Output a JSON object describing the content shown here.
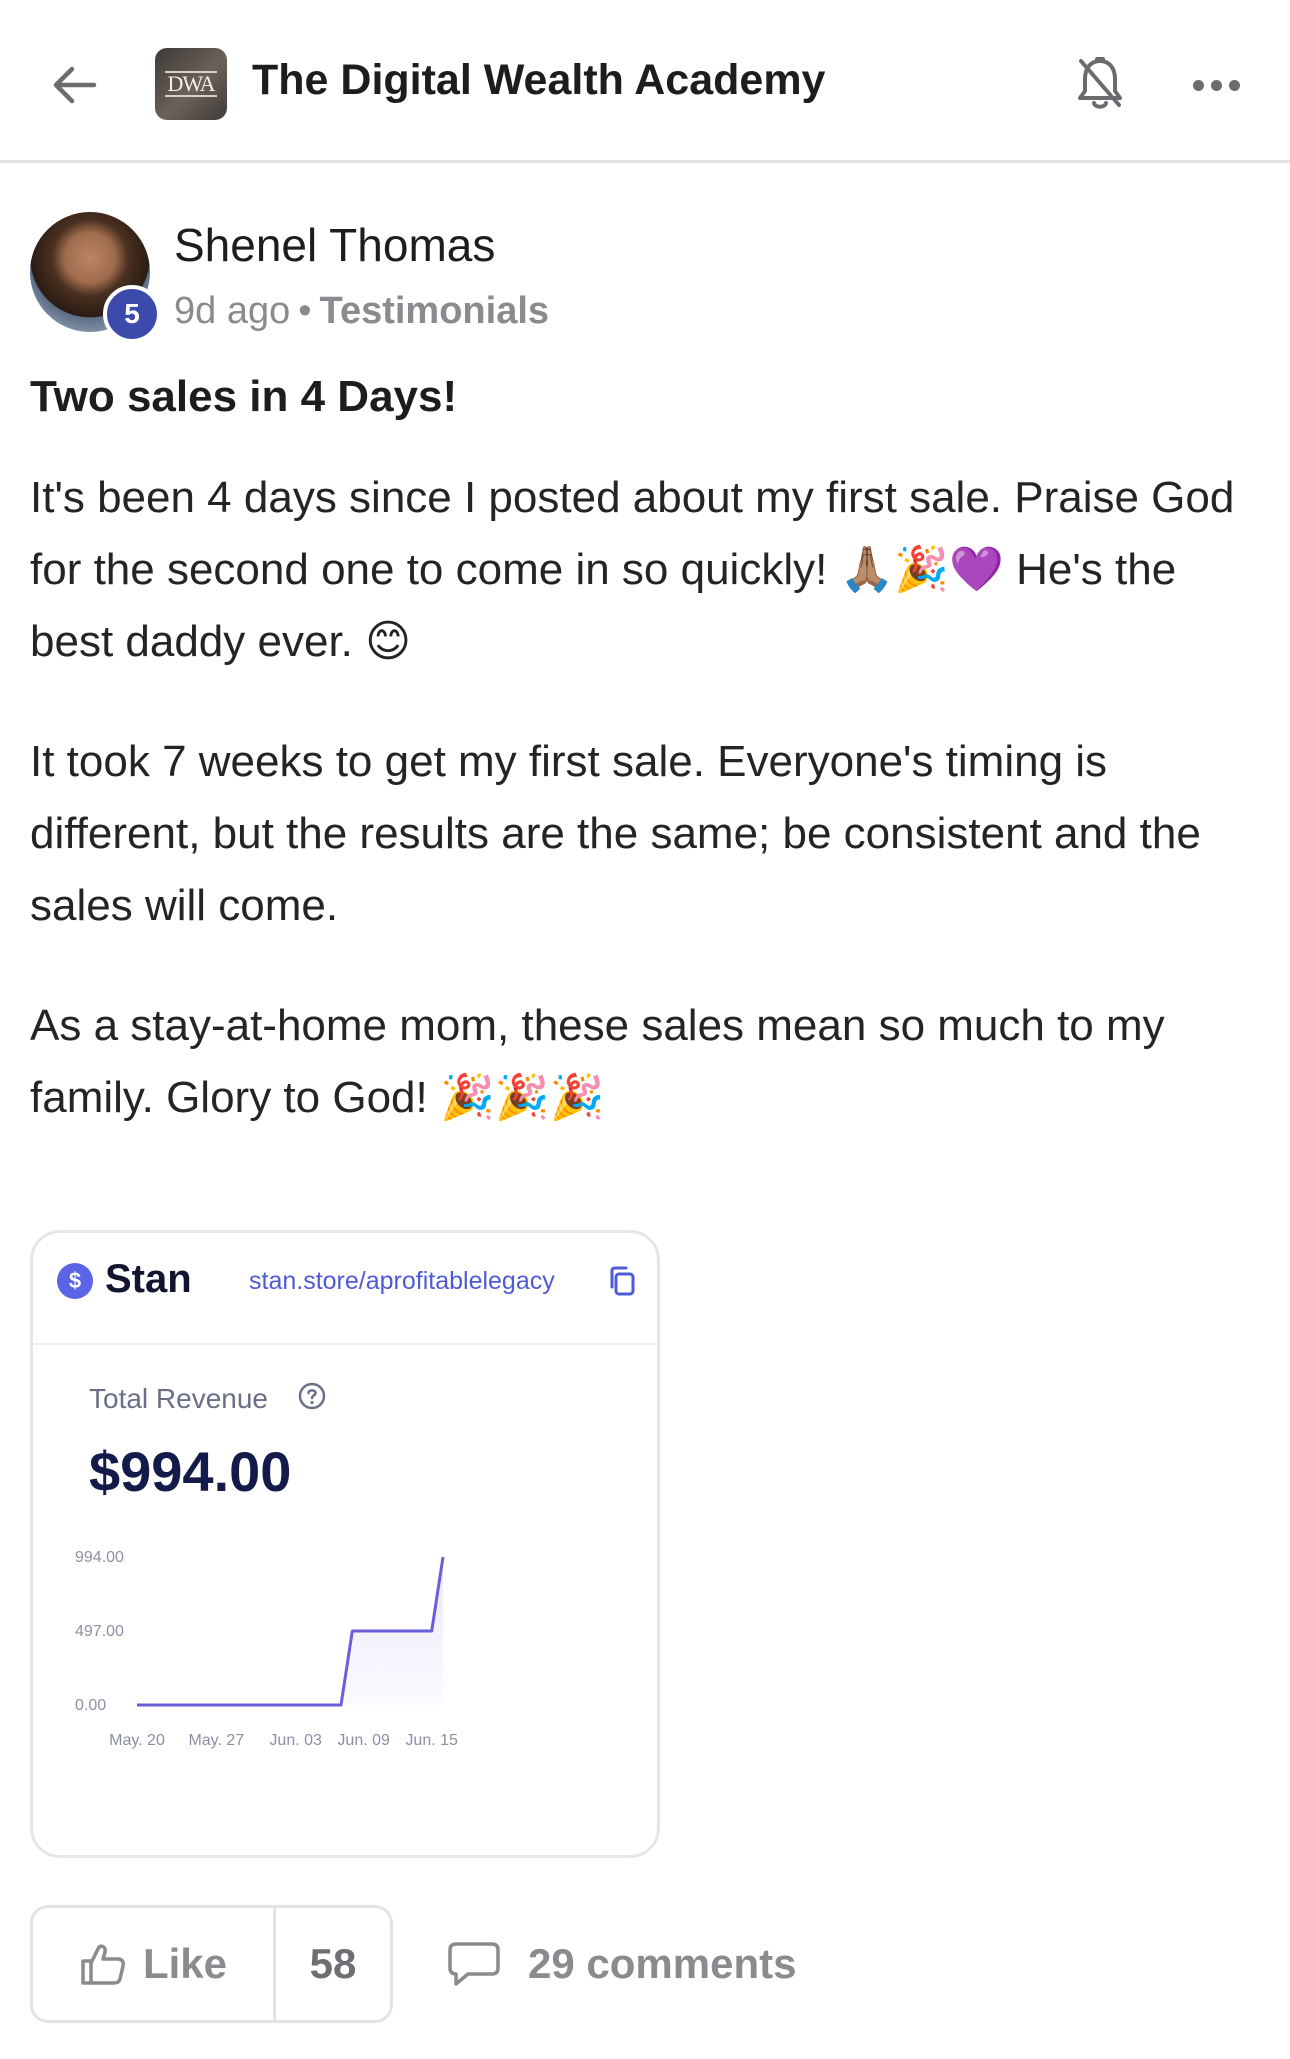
{
  "header": {
    "group_logo_text": "DWA",
    "group_title": "The Digital Wealth Academy"
  },
  "author": {
    "name": "Shenel Thomas",
    "level": "5",
    "time_ago": "9d ago",
    "separator": "•",
    "category": "Testimonials"
  },
  "post": {
    "title": "Two sales in 4 Days!",
    "paragraphs": [
      "It's been 4 days since I posted about my first sale. Praise God for the second one to come in so quickly! 🙏🏽🎉💜 He's the best daddy ever. 😊",
      "It took 7 weeks to get my first sale. Everyone's timing is different, but the results are the same; be consistent and the sales will come.",
      "As a stay-at-home mom, these sales mean so much to my family. Glory to God! 🎉🎉🎉"
    ]
  },
  "card": {
    "brand": "Stan",
    "brand_icon": "$",
    "url": "stan.store/aprofitablelegacy",
    "revenue_label": "Total Revenue",
    "revenue_value": "$994.00"
  },
  "chart_data": {
    "type": "area",
    "x_tick_labels": [
      "May. 20",
      "May. 27",
      "Jun. 03",
      "Jun. 09",
      "Jun. 15"
    ],
    "y_tick_labels": [
      "994.00",
      "497.00",
      "0.00"
    ],
    "ylim": [
      0,
      994
    ],
    "series": [
      {
        "x": [
          "May. 20",
          "Jun. 07",
          "Jun. 08",
          "Jun. 15",
          "Jun. 16"
        ],
        "values": [
          0,
          0,
          497,
          497,
          994
        ]
      }
    ],
    "line_color": "#6a5ed9",
    "fill_color": "#ece9fb",
    "grid": false
  },
  "actions": {
    "like_label": "Like",
    "like_count": "58",
    "comments_label": "29 comments"
  }
}
